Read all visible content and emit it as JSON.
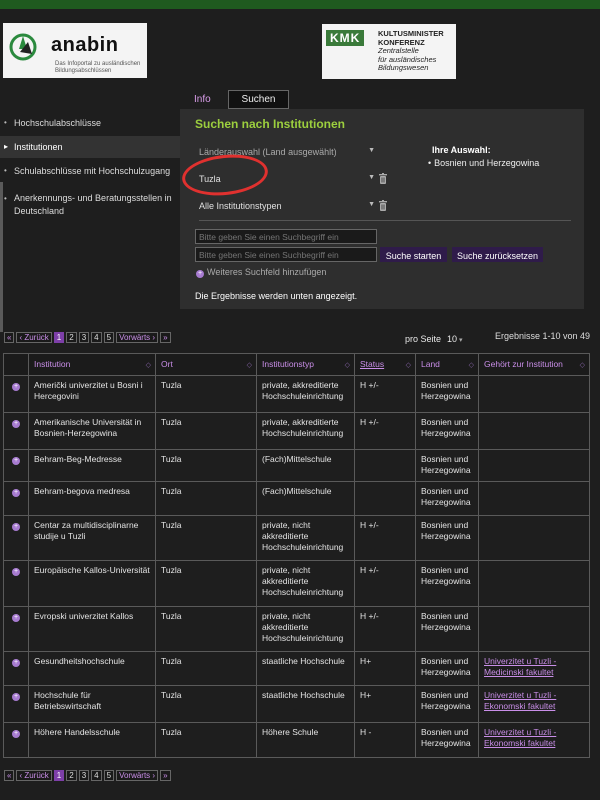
{
  "logos": {
    "anabin_name": "anabin",
    "anabin_tagline_1": "Das Infoportal zu ausländischen",
    "anabin_tagline_2": "Bildungsabschlüssen",
    "kmk_letters": "KMK",
    "kmk_line_1": "KULTUSMINISTER",
    "kmk_line_2": "KONFERENZ",
    "kmk_line_3": "Zentralstelle",
    "kmk_line_4": "für ausländisches",
    "kmk_line_5": "Bildungswesen"
  },
  "tabs": {
    "info": "Info",
    "suchen": "Suchen"
  },
  "sidebar": {
    "items": [
      "Hochschulabschlüsse",
      "Institutionen",
      "Schulabschlüsse mit Hochschulzugang",
      "Anerkennungs- und Beratungsstellen in Deutschland"
    ]
  },
  "search": {
    "title": "Suchen nach Institutionen",
    "country_select": "Länderauswahl (Land ausgewählt)",
    "city_select": "Tuzla",
    "type_select": "Alle Institutionstypen",
    "choice_title": "Ihre Auswahl:",
    "choice_value": "Bosnien und Herzegowina",
    "input_placeholder": "Bitte geben Sie einen Suchbegriff ein",
    "btn_search": "Suche starten",
    "btn_reset": "Suche zurücksetzen",
    "add_field": "Weiteres Suchfeld hinzufügen",
    "results_note": "Die Ergebnisse werden unten angezeigt."
  },
  "pagination": {
    "first": "«",
    "prev": "‹ Zurück",
    "pages": [
      "1",
      "2",
      "3",
      "4",
      "5"
    ],
    "current": "1",
    "next": "Vorwärts ›",
    "last": "»",
    "per_page_label": "pro Seite",
    "per_page_value": "10",
    "results_range": "Ergebnisse 1-10 von 49"
  },
  "table": {
    "headers": [
      "Institution",
      "Ort",
      "Institutionstyp",
      "Status",
      "Land",
      "Gehört zur Institution"
    ],
    "rows": [
      {
        "institution": "Američki univerzitet u Bosni i Hercegovini",
        "ort": "Tuzla",
        "typ": "private, akkreditierte Hochschuleinrichtung",
        "status": "H +/-",
        "land": "Bosnien und Herzegowina",
        "parent": ""
      },
      {
        "institution": "Amerikanische Universität in Bosnien-Herzegowina",
        "ort": "Tuzla",
        "typ": "private, akkreditierte Hochschuleinrichtung",
        "status": "H +/-",
        "land": "Bosnien und Herzegowina",
        "parent": ""
      },
      {
        "institution": "Behram-Beg-Medresse",
        "ort": "Tuzla",
        "typ": "(Fach)Mittelschule",
        "status": "",
        "land": "Bosnien und Herzegowina",
        "parent": ""
      },
      {
        "institution": "Behram-begova medresa",
        "ort": "Tuzla",
        "typ": "(Fach)Mittelschule",
        "status": "",
        "land": "Bosnien und Herzegowina",
        "parent": ""
      },
      {
        "institution": "Centar za multidisciplinarne studije u Tuzli",
        "ort": "Tuzla",
        "typ": "private, nicht akkreditierte Hochschuleinrichtung",
        "status": "H +/-",
        "land": "Bosnien und Herzegowina",
        "parent": ""
      },
      {
        "institution": "Europäische Kallos-Universität",
        "ort": "Tuzla",
        "typ": "private, nicht akkreditierte Hochschuleinrichtung",
        "status": "H +/-",
        "land": "Bosnien und Herzegowina",
        "parent": ""
      },
      {
        "institution": "Evropski univerzitet Kallos",
        "ort": "Tuzla",
        "typ": "private, nicht akkreditierte Hochschuleinrichtung",
        "status": "H +/-",
        "land": "Bosnien und Herzegowina",
        "parent": ""
      },
      {
        "institution": "Gesundheitshochschule",
        "ort": "Tuzla",
        "typ": "staatliche Hochschule",
        "status": "H+",
        "land": "Bosnien und Herzegowina",
        "parent": "Univerzitet u Tuzli - Medicinski fakultet"
      },
      {
        "institution": "Hochschule für Betriebswirtschaft",
        "ort": "Tuzla",
        "typ": "staatliche Hochschule",
        "status": "H+",
        "land": "Bosnien und Herzegowina",
        "parent": "Univerzitet u Tuzli - Ekonomski fakultet"
      },
      {
        "institution": "Höhere Handelsschule",
        "ort": "Tuzla",
        "typ": "Höhere Schule",
        "status": "H -",
        "land": "Bosnien und Herzegowina",
        "parent": "Univerzitet u Tuzli - Ekonomski fakultet"
      }
    ]
  },
  "colors": {
    "accent_purple": "#c98ee8",
    "title_green": "#9ccf3e",
    "button_bg": "#2f1b4a",
    "annotation_red": "#e0312f"
  }
}
